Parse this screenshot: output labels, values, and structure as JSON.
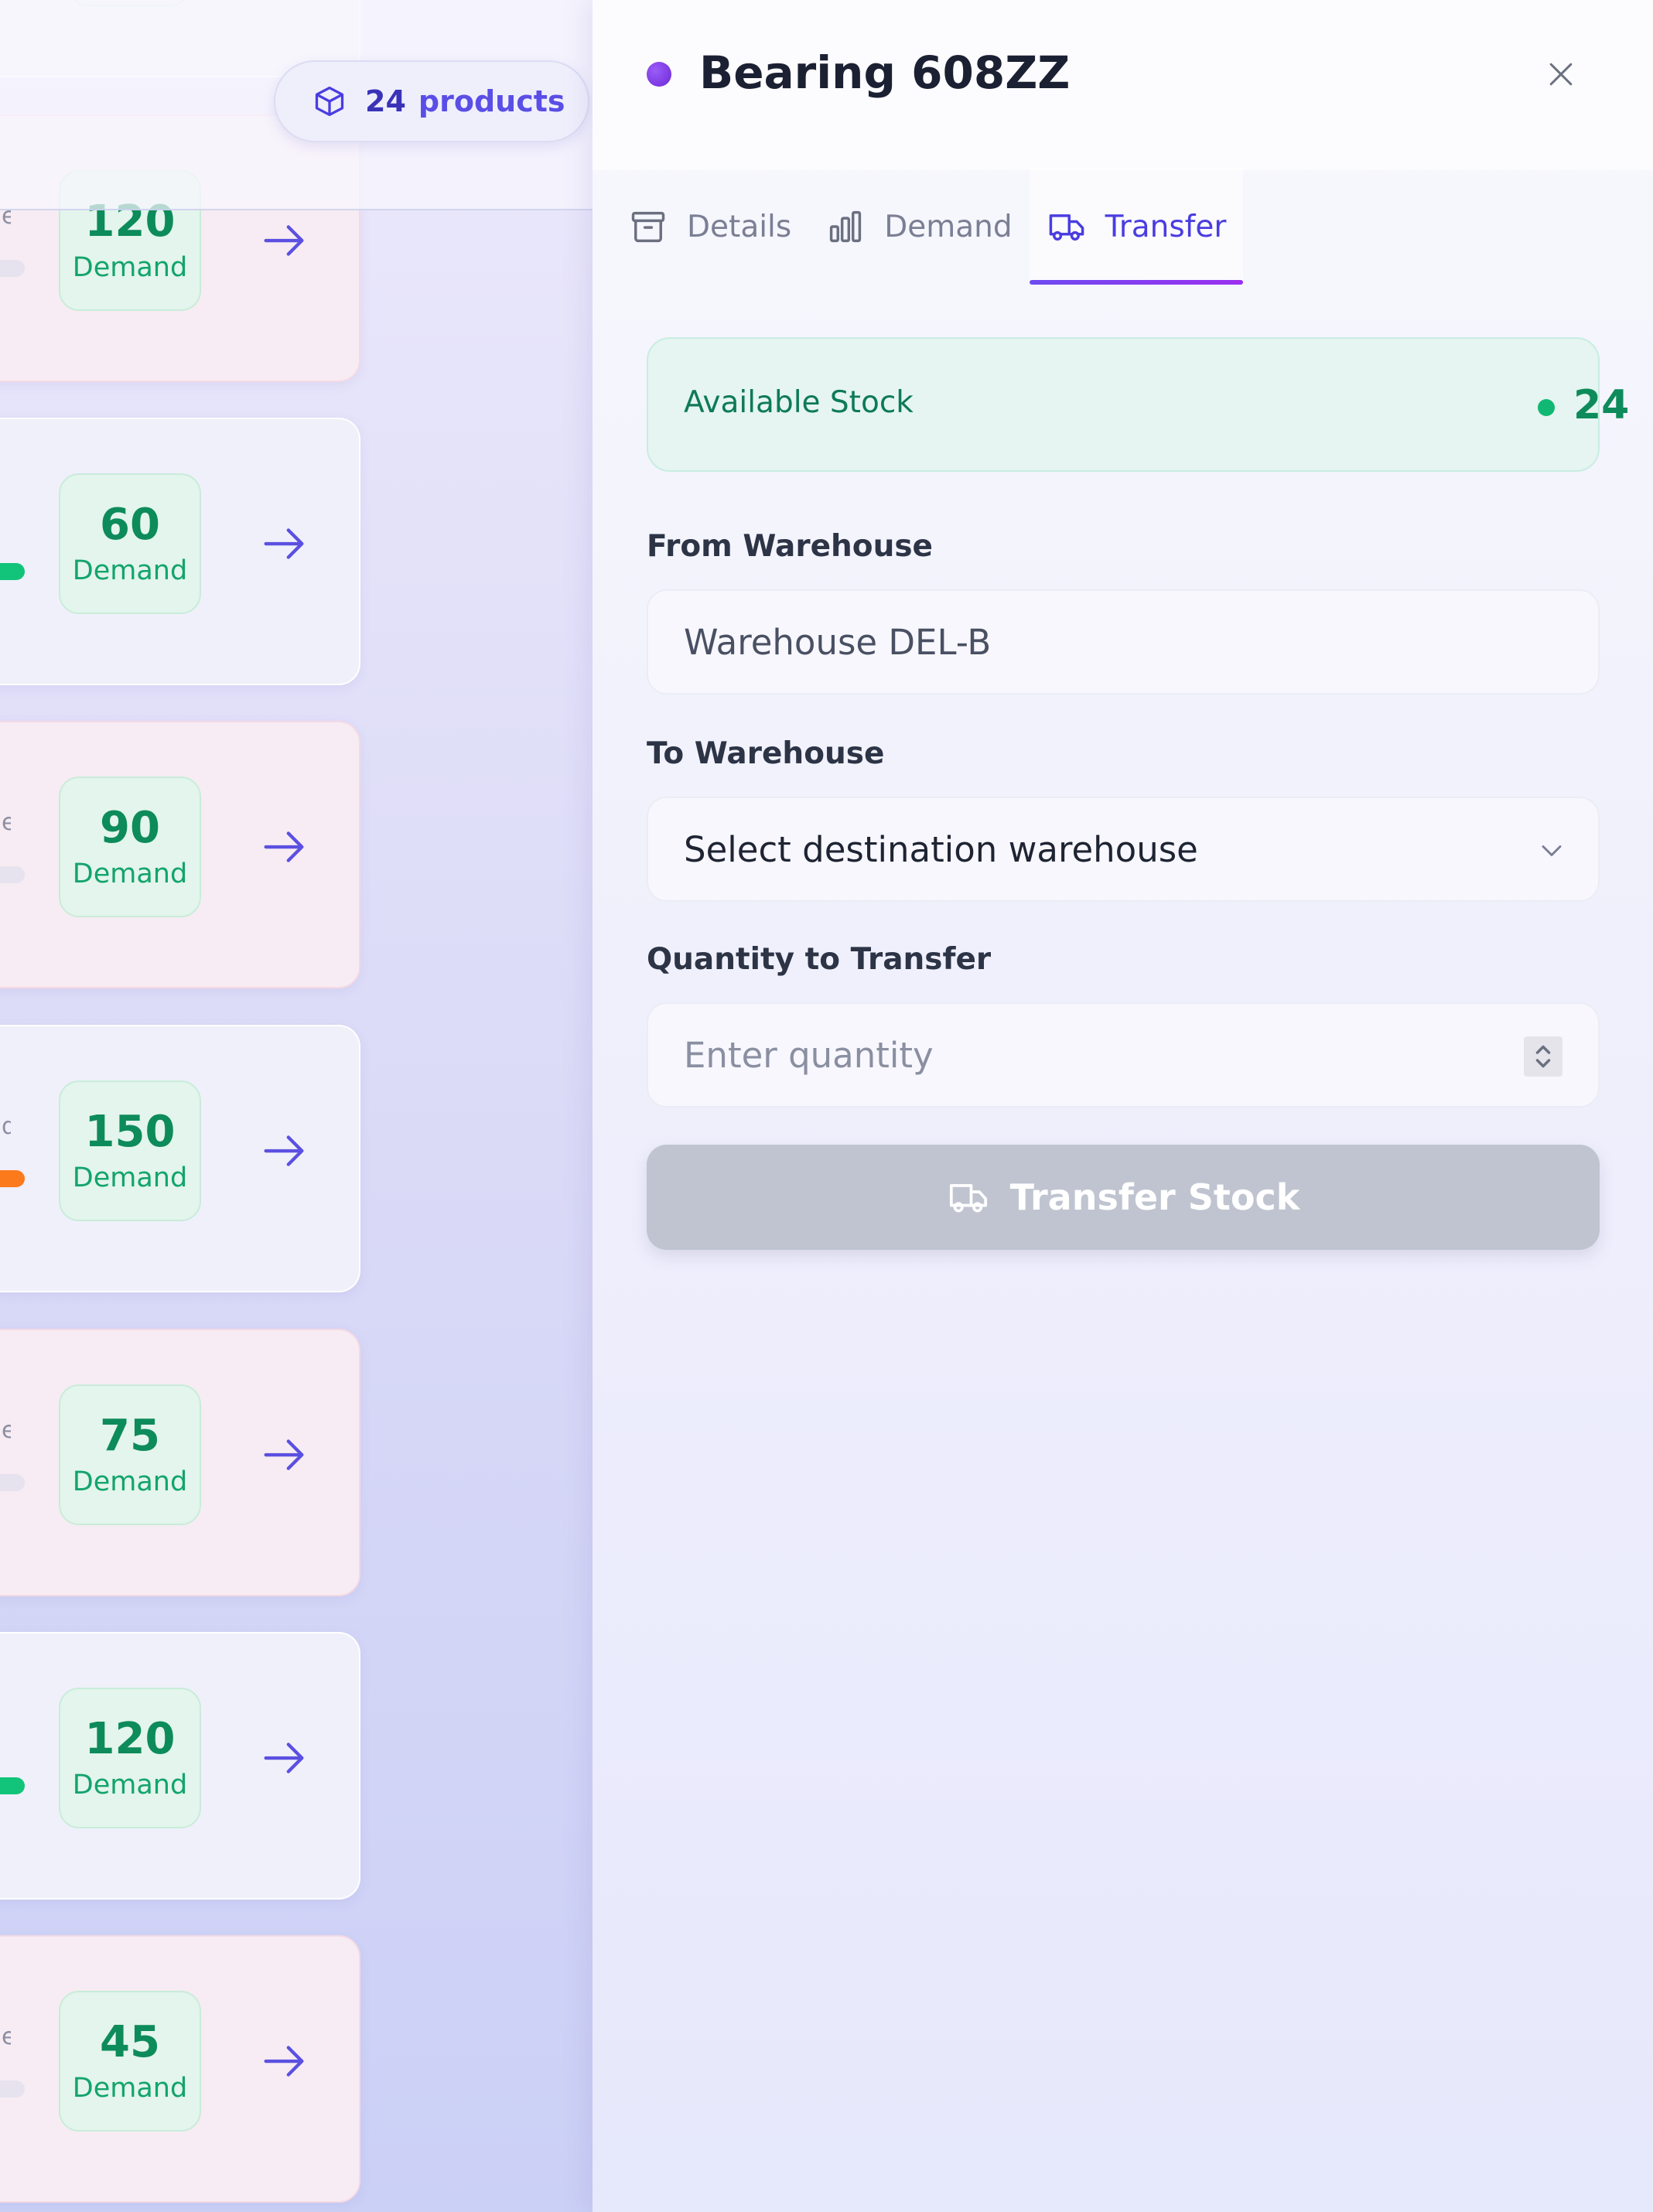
{
  "products_count": {
    "number": "24",
    "label": "products"
  },
  "cards": [
    {
      "demand": "120",
      "demand_label": "Demand",
      "edge_text": "e",
      "bar": "none",
      "tone": "pink"
    },
    {
      "demand": "60",
      "demand_label": "Demand",
      "edge_text": "",
      "bar": "green",
      "tone": "lav"
    },
    {
      "demand": "90",
      "demand_label": "Demand",
      "edge_text": "e",
      "bar": "none",
      "tone": "pink"
    },
    {
      "demand": "150",
      "demand_label": "Demand",
      "edge_text": "d",
      "bar": "orange",
      "tone": "lav"
    },
    {
      "demand": "75",
      "demand_label": "Demand",
      "edge_text": "e",
      "bar": "none",
      "tone": "pink"
    },
    {
      "demand": "120",
      "demand_label": "Demand",
      "edge_text": "",
      "bar": "green",
      "tone": "lav"
    },
    {
      "demand": "45",
      "demand_label": "Demand",
      "edge_text": "e",
      "bar": "none",
      "tone": "pink"
    }
  ],
  "drawer": {
    "title": "Bearing 608ZZ",
    "tabs": [
      {
        "label": "Details",
        "icon": "archive-icon",
        "active": false
      },
      {
        "label": "Demand",
        "icon": "bar-chart-icon",
        "active": false
      },
      {
        "label": "Transfer",
        "icon": "truck-icon",
        "active": true
      }
    ],
    "stock": {
      "label": "Available Stock",
      "value": "24"
    },
    "from": {
      "label": "From Warehouse",
      "value": "Warehouse DEL-B"
    },
    "to": {
      "label": "To Warehouse",
      "value": "Select destination warehouse"
    },
    "quantity": {
      "label": "Quantity to Transfer",
      "placeholder": "Enter quantity"
    },
    "submit_label": "Transfer Stock"
  },
  "colors": {
    "accent": "#4a3de0",
    "success": "#0d8b5b",
    "button_disabled": "#bfc4d0"
  }
}
